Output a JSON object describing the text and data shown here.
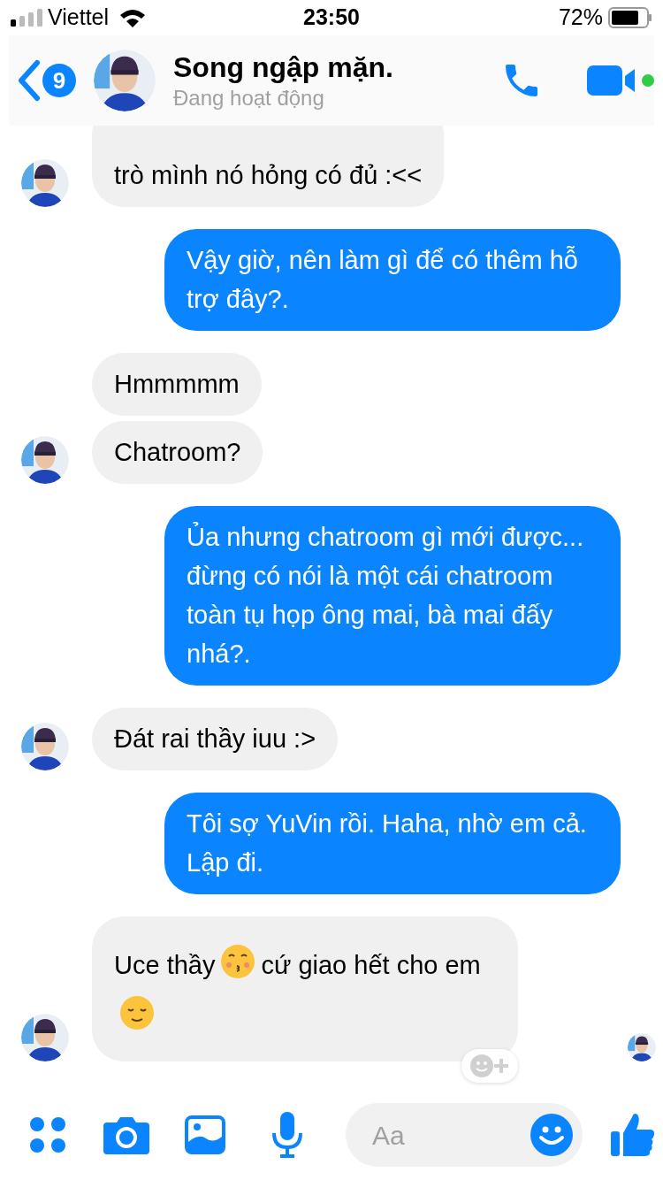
{
  "status_bar": {
    "carrier": "Viettel",
    "time": "23:50",
    "battery": "72%"
  },
  "header": {
    "badge": "9",
    "name": "Song ngập mặn.",
    "status": "Đang hoạt động",
    "online": true
  },
  "messages": [
    {
      "kind": "received",
      "avatar": true,
      "parts": [
        {
          "kind": "text",
          "text": "trò mình nó hỏng có đủ :<<"
        }
      ]
    },
    {
      "kind": "sent",
      "parts": [
        {
          "kind": "text",
          "text": "Vậy giờ, nên làm gì để có thêm hỗ trợ đây?."
        }
      ]
    },
    {
      "kind": "received",
      "avatar": false,
      "parts": [
        {
          "kind": "text",
          "text": "Hmmmmm"
        }
      ]
    },
    {
      "kind": "received",
      "avatar": true,
      "parts": [
        {
          "kind": "text",
          "text": "Chatroom?"
        }
      ]
    },
    {
      "kind": "sent",
      "parts": [
        {
          "kind": "text",
          "text": "Ủa nhưng chatroom gì mới được... đừng có nói là một cái chatroom toàn tụ họp ông mai, bà mai đấy nhá?."
        }
      ]
    },
    {
      "kind": "received",
      "avatar": true,
      "parts": [
        {
          "kind": "text",
          "text": "Đát rai thầy iuu :>"
        }
      ]
    },
    {
      "kind": "sent",
      "parts": [
        {
          "kind": "text",
          "text": "Tôi sợ YuVin rồi. Haha, nhờ em cả. Lập đi."
        }
      ]
    },
    {
      "kind": "received",
      "avatar": true,
      "seen": true,
      "reaction_button": true,
      "parts": [
        {
          "kind": "text",
          "text": "Uce thầy"
        },
        {
          "kind": "kiss"
        },
        {
          "kind": "text",
          "text": "cứ giao hết cho em"
        },
        {
          "kind": "relieved"
        }
      ]
    }
  ],
  "composer": {
    "placeholder": "Aa"
  }
}
